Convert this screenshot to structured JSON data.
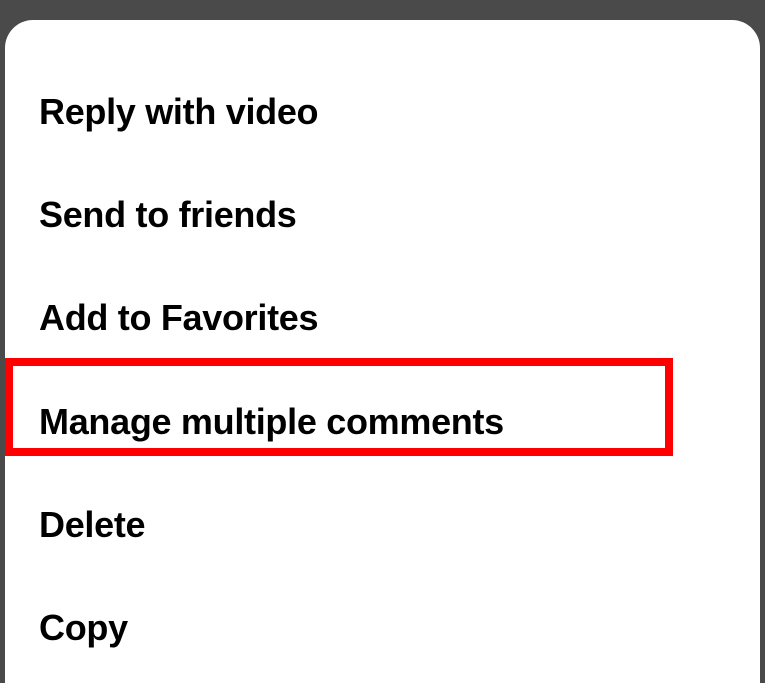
{
  "menu": {
    "items": [
      {
        "label": "Reply with video",
        "name": "menu-item-reply-with-video",
        "highlighted": false
      },
      {
        "label": "Send to friends",
        "name": "menu-item-send-to-friends",
        "highlighted": false
      },
      {
        "label": "Add to Favorites",
        "name": "menu-item-add-to-favorites",
        "highlighted": false
      },
      {
        "label": "Manage multiple comments",
        "name": "menu-item-manage-multiple-comments",
        "highlighted": true
      },
      {
        "label": "Delete",
        "name": "menu-item-delete",
        "highlighted": false
      },
      {
        "label": "Copy",
        "name": "menu-item-copy",
        "highlighted": false
      }
    ]
  },
  "highlight_color": "#ff0000"
}
